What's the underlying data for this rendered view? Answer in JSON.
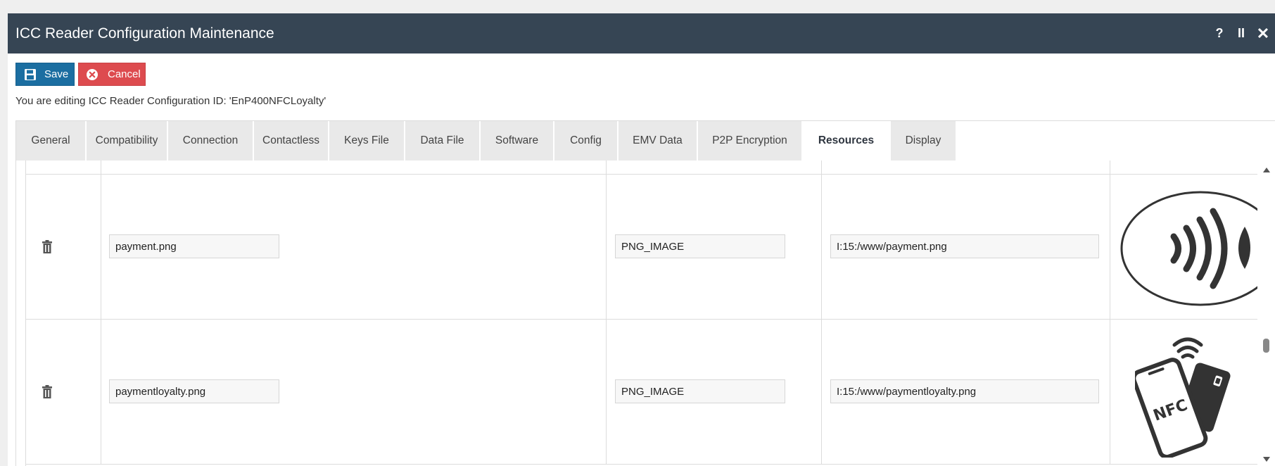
{
  "window": {
    "title": "ICC Reader Configuration Maintenance",
    "help_label": "?",
    "pause_label": "II",
    "close_label": "✕"
  },
  "toolbar": {
    "save_label": "Save",
    "cancel_label": "Cancel"
  },
  "editing_message": "You are editing ICC Reader Configuration ID: 'EnP400NFCLoyalty'",
  "tabs": [
    {
      "label": "General"
    },
    {
      "label": "Compatibility"
    },
    {
      "label": "Connection"
    },
    {
      "label": "Contactless"
    },
    {
      "label": "Keys File"
    },
    {
      "label": "Data File"
    },
    {
      "label": "Software"
    },
    {
      "label": "Config"
    },
    {
      "label": "EMV Data"
    },
    {
      "label": "P2P Encryption"
    },
    {
      "label": "Resources",
      "active": true
    },
    {
      "label": "Display"
    }
  ],
  "resources": {
    "rows": [
      {
        "name": "payment.png",
        "type": "PNG_IMAGE",
        "path": "I:15:/www/payment.png",
        "preview_icon": "contactless-payment-icon"
      },
      {
        "name": "paymentloyalty.png",
        "type": "PNG_IMAGE",
        "path": "I:15:/www/paymentloyalty.png",
        "preview_icon": "nfc-phone-card-icon"
      }
    ]
  },
  "colors": {
    "titlebar": "#364554",
    "save_button": "#1b6ea1",
    "cancel_button": "#dd4b4f"
  }
}
